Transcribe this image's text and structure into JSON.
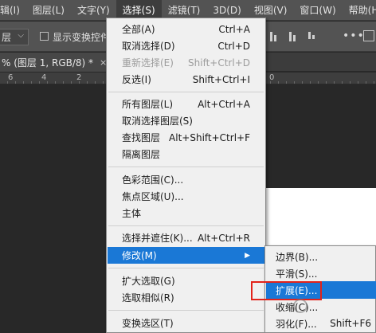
{
  "menubar": {
    "items": [
      {
        "label": "辑(I)"
      },
      {
        "label": "图层(L)"
      },
      {
        "label": "文字(Y)"
      },
      {
        "label": "选择(S)"
      },
      {
        "label": "滤镜(T)"
      },
      {
        "label": "3D(D)"
      },
      {
        "label": "视图(V)"
      },
      {
        "label": "窗口(W)"
      },
      {
        "label": "帮助(H)"
      }
    ]
  },
  "options": {
    "layer_value": "层",
    "transform_label": "显示变换控件"
  },
  "document": {
    "tab_label": "% (图层 1, RGB/8) *",
    "close_glyph": "×"
  },
  "ruler": {
    "labels": [
      "6",
      "4",
      "2",
      "0"
    ]
  },
  "select_menu": {
    "items": [
      {
        "label": "全部(A)",
        "shortcut": "Ctrl+A",
        "disabled": false
      },
      {
        "label": "取消选择(D)",
        "shortcut": "Ctrl+D",
        "disabled": false
      },
      {
        "label": "重新选择(E)",
        "shortcut": "Shift+Ctrl+D",
        "disabled": true
      },
      {
        "label": "反选(I)",
        "shortcut": "Shift+Ctrl+I",
        "disabled": false
      },
      {
        "label": "所有图层(L)",
        "shortcut": "Alt+Ctrl+A",
        "disabled": false
      },
      {
        "label": "取消选择图层(S)",
        "shortcut": "",
        "disabled": false
      },
      {
        "label": "查找图层",
        "shortcut": "Alt+Shift+Ctrl+F",
        "disabled": false
      },
      {
        "label": "隔离图层",
        "shortcut": "",
        "disabled": false
      },
      {
        "label": "色彩范围(C)...",
        "shortcut": "",
        "disabled": false
      },
      {
        "label": "焦点区域(U)...",
        "shortcut": "",
        "disabled": false
      },
      {
        "label": "主体",
        "shortcut": "",
        "disabled": false
      },
      {
        "label": "选择并遮住(K)...",
        "shortcut": "Alt+Ctrl+R",
        "disabled": false
      },
      {
        "label": "修改(M)",
        "shortcut": "",
        "disabled": false,
        "highlighted": true,
        "submenu_arrow": "▶"
      },
      {
        "label": "扩大选取(G)",
        "shortcut": "",
        "disabled": false
      },
      {
        "label": "选取相似(R)",
        "shortcut": "",
        "disabled": false
      },
      {
        "label": "变换选区(T)",
        "shortcut": "",
        "disabled": false
      }
    ]
  },
  "modify_submenu": {
    "items": [
      {
        "label": "边界(B)...",
        "shortcut": ""
      },
      {
        "label": "平滑(S)...",
        "shortcut": ""
      },
      {
        "label": "扩展(E)...",
        "shortcut": "",
        "highlighted": true
      },
      {
        "label": "收缩(C)...",
        "shortcut": ""
      },
      {
        "label": "羽化(F)...",
        "shortcut": "Shift+F6"
      }
    ]
  },
  "colors": {
    "highlight": "#1a78d6",
    "menu_bg": "#f0f0f0",
    "annotation_red": "#e2231a"
  }
}
